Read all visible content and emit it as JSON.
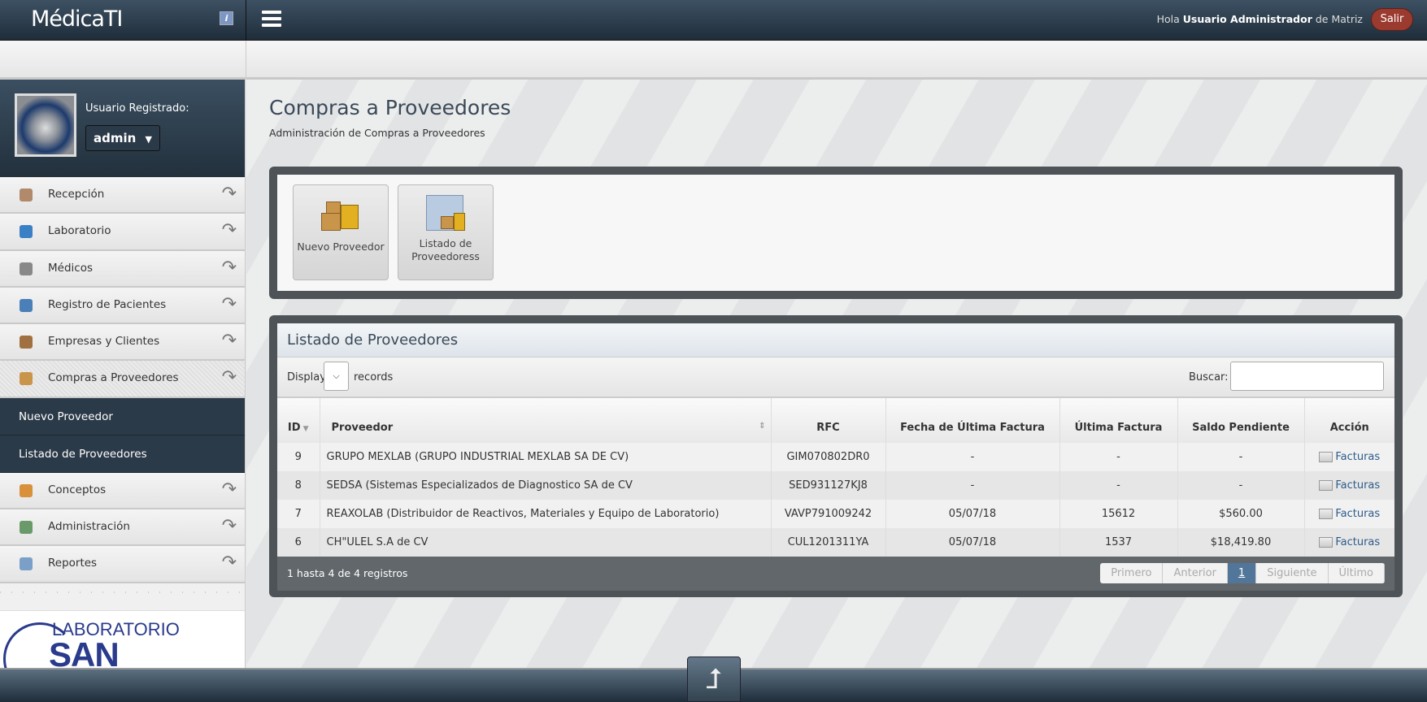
{
  "app": {
    "logo": "MédicaTI",
    "info_icon": "info-icon",
    "menu_icon": "hamburger-icon"
  },
  "header": {
    "greeting_prefix": "Hola",
    "user": "Usuario Administrador",
    "greeting_suffix": "de Matriz",
    "logout": "Salir"
  },
  "user": {
    "label": "Usuario Registrado:",
    "name": "admin"
  },
  "sidebar": {
    "items": [
      {
        "label": "Recepción",
        "icon": "couch-icon",
        "color": "#b08a6a"
      },
      {
        "label": "Laboratorio",
        "icon": "flask-icon",
        "color": "#3b7fc4"
      },
      {
        "label": "Médicos",
        "icon": "stethoscope-icon",
        "color": "#888888"
      },
      {
        "label": "Registro de Pacientes",
        "icon": "patient-icon",
        "color": "#4a7fb8"
      },
      {
        "label": "Empresas y Clientes",
        "icon": "building-icon",
        "color": "#a07040"
      },
      {
        "label": "Compras a Proveedores",
        "icon": "forklift-icon",
        "color": "#c9954a"
      },
      {
        "label": "Conceptos",
        "icon": "box-icon",
        "color": "#d8903a"
      },
      {
        "label": "Administración",
        "icon": "form-icon",
        "color": "#6a9a6a"
      },
      {
        "label": "Reportes",
        "icon": "report-icon",
        "color": "#7aa0c8"
      }
    ],
    "submenu": [
      "Nuevo Proveedor",
      "Listado de Proveedores"
    ],
    "logo_text": [
      "LABORATORIO",
      "SAN RAFAEL"
    ]
  },
  "page": {
    "title": "Compras a Proveedores",
    "subtitle": "Administración de Compras a Proveedores"
  },
  "toolbar": {
    "buttons": [
      {
        "label": "Nuevo Proveedor",
        "icon": "forklift-boxes-icon"
      },
      {
        "label": "Listado de Proveedoress",
        "icon": "folder-forklift-icon"
      }
    ]
  },
  "list": {
    "title": "Listado de Proveedores",
    "display": "Display",
    "records": "records",
    "search_label": "Buscar:",
    "search_value": "",
    "columns": [
      "ID",
      "Proveedor",
      "RFC",
      "Fecha de Última Factura",
      "Última Factura",
      "Saldo Pendiente",
      "Acción"
    ],
    "rows": [
      [
        "9",
        "GRUPO MEXLAB (GRUPO INDUSTRIAL MEXLAB SA DE CV)",
        "GIM070802DR0",
        "-",
        "-",
        "-",
        "Facturas"
      ],
      [
        "8",
        "SEDSA (Sistemas Especializados de Diagnostico SA de CV",
        "SED931127KJ8",
        "-",
        "-",
        "-",
        "Facturas"
      ],
      [
        "7",
        "REAXOLAB (Distribuidor de Reactivos, Materiales y Equipo de Laboratorio)",
        "VAVP791009242",
        "05/07/18",
        "15612",
        "$560.00",
        "Facturas"
      ],
      [
        "6",
        "CH\"ULEL S.A de CV",
        "CUL1201311YA",
        "05/07/18",
        "1537",
        "$18,419.80",
        "Facturas"
      ]
    ],
    "info": "1 hasta 4 de 4 registros",
    "pager": [
      "Primero",
      "Anterior",
      "1",
      "Siguiente",
      "Último"
    ]
  },
  "footer": {
    "up_icon": "arrow-up-icon"
  }
}
